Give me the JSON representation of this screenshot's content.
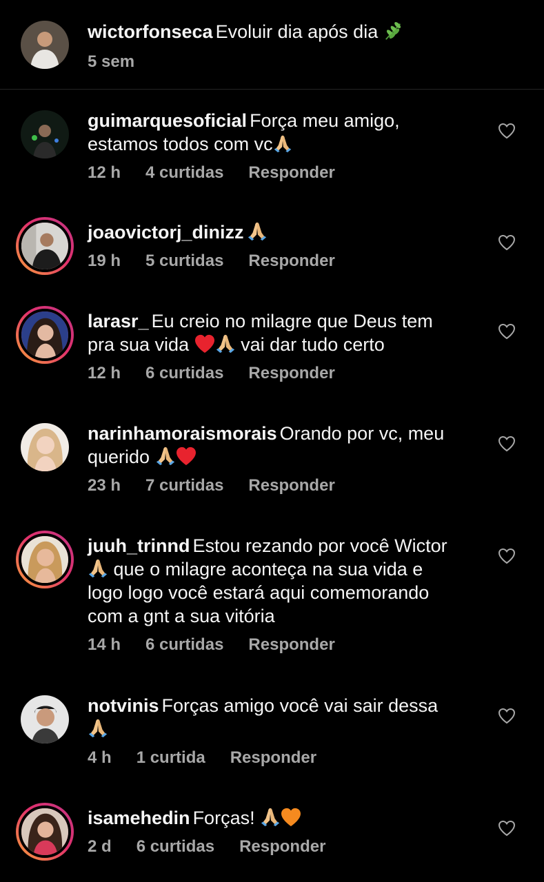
{
  "caption": {
    "username": "wictorfonseca",
    "text": "Evoluir dia após dia",
    "time": "5 sem"
  },
  "comments": [
    {
      "username": "guimarquesoficial",
      "text_1": "Força meu amigo,",
      "text_2": "estamos todos com vc",
      "time": "12 h",
      "likes": "4 curtidas",
      "reply": "Responder"
    },
    {
      "username": "joaovictorj_dinizz",
      "time": "19 h",
      "likes": "5 curtidas",
      "reply": "Responder"
    },
    {
      "username": "larasr_",
      "text_1": "Eu creio no milagre que Deus tem",
      "text_2a": "pra sua vida",
      "text_2b": "vai dar tudo certo",
      "time": "12 h",
      "likes": "6 curtidas",
      "reply": "Responder"
    },
    {
      "username": "narinhamoraismorais",
      "text_1": "Orando por vc, meu",
      "text_2": "querido",
      "time": "23 h",
      "likes": "7 curtidas",
      "reply": "Responder"
    },
    {
      "username": "juuh_trinnd",
      "text_1": "Estou rezando por você Wictor",
      "text_2": "que o milagre aconteça na sua vida e",
      "text_3": "logo logo você estará aqui comemorando",
      "text_4": "com a gnt a sua vitória",
      "time": "14 h",
      "likes": "6 curtidas",
      "reply": "Responder"
    },
    {
      "username": "notvinis",
      "text_1": "Forças amigo você vai sair dessa",
      "time": "4 h",
      "likes": "1 curtida",
      "reply": "Responder"
    },
    {
      "username": "isamehedin",
      "text_1": "Forças!",
      "time": "2 d",
      "likes": "6 curtidas",
      "reply": "Responder"
    }
  ],
  "icons": {
    "like": "heart-outline-icon",
    "caption_emoji": "herb-emoji",
    "pray": "folded-hands-emoji",
    "red_heart": "red-heart-emoji",
    "orange_heart": "orange-heart-emoji"
  },
  "colors": {
    "background": "#000000",
    "text": "#f5f5f5",
    "meta_text": "#a8a8a8",
    "divider": "#262626",
    "story_ring_start": "#f9a23a",
    "story_ring_end": "#c13584",
    "heart_red": "#e8232e",
    "heart_orange": "#f58a1f"
  }
}
